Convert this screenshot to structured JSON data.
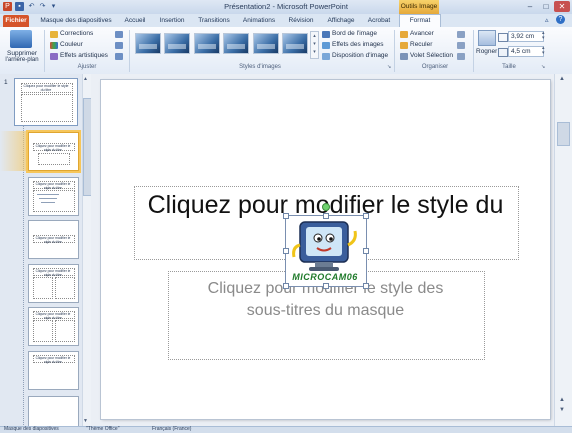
{
  "titlebar": {
    "title": "Présentation2 - Microsoft PowerPoint",
    "contextual_label": "Outils Image",
    "minimize": "–",
    "maximize": "□",
    "close": "✕"
  },
  "tabs": {
    "fichier": "Fichier",
    "masque": "Masque des diapositives",
    "accueil": "Accueil",
    "insertion": "Insertion",
    "transitions": "Transitions",
    "animations": "Animations",
    "revision": "Révision",
    "affichage": "Affichage",
    "acrobat": "Acrobat",
    "format": "Format"
  },
  "ribbon": {
    "supprimer_label": "Supprimer",
    "supprimer_label2": "l'arrière-plan",
    "corrections": "Corrections",
    "couleur": "Couleur",
    "effets_artistiques": "Effets artistiques",
    "ajuster_group": "Ajuster",
    "styles_group": "Styles d'images",
    "bordure": "Bord de l'image",
    "effets_image": "Effets des images",
    "disposition": "Disposition d'image",
    "avancer": "Avancer",
    "reculer": "Reculer",
    "volet_selection": "Volet Sélection",
    "organiser_group": "Organiser",
    "rogner": "Rogner",
    "height_value": "3,92 cm",
    "width_value": "4,5 cm",
    "taille_group": "Taille"
  },
  "slides": {
    "master_number": "1",
    "master_title": "Cliquez pour modifier le style du titre",
    "thumb_title": "Cliquez pour modifier le style du titre"
  },
  "slide": {
    "title_placeholder": "Cliquez pour modifier le style du",
    "subtitle_line1": "Cliquez pour modifier le style des",
    "subtitle_line2": "sous-titres du masque"
  },
  "image": {
    "logo_text": "MICROCAM06"
  },
  "statusbar": {
    "mode": "Masque des diapositives",
    "theme": "\"Thème Office\"",
    "language": "Français (France)"
  },
  "colors": {
    "fichier_tab": "#d5542a",
    "contextual_tab": "#f2c14e",
    "logo_green": "#1f7a2a"
  }
}
